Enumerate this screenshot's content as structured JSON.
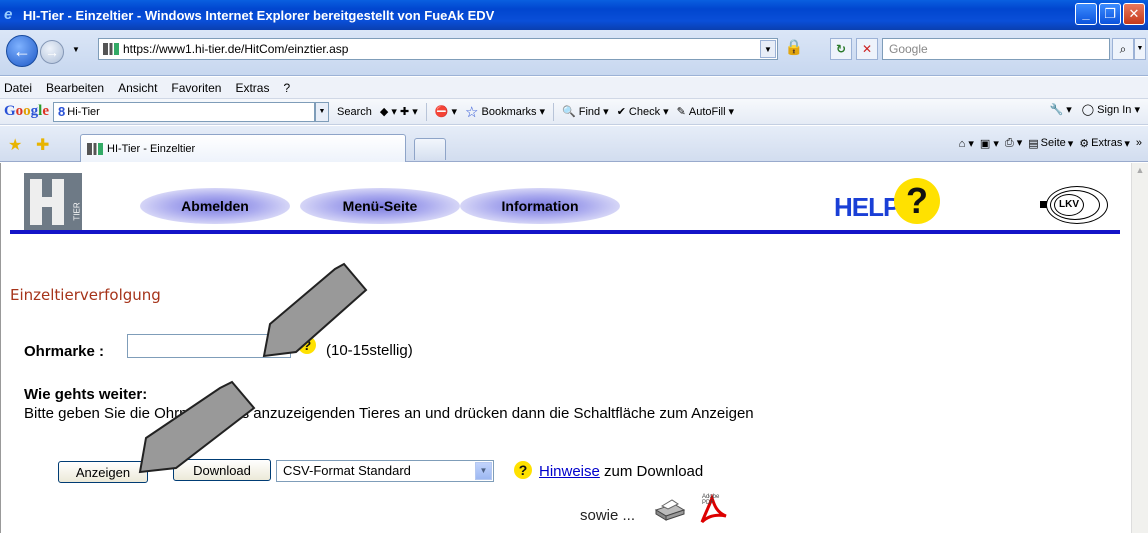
{
  "window": {
    "title": "HI-Tier - Einzeltier - Windows Internet Explorer bereitgestellt von FueAk EDV"
  },
  "addressbar": {
    "url": "https://www1.hi-tier.de/HitCom/einztier.asp",
    "search_placeholder": "Google"
  },
  "menubar": {
    "items": [
      "Datei",
      "Bearbeiten",
      "Ansicht",
      "Favoriten",
      "Extras",
      "?"
    ]
  },
  "google_toolbar": {
    "search_value": "Hi-Tier",
    "search_label": "Search",
    "bookmarks_label": "Bookmarks",
    "find_label": "Find",
    "check_label": "Check",
    "autofill_label": "AutoFill",
    "signin_label": "Sign In"
  },
  "tabs": {
    "active_label": "HI-Tier - Einzeltier",
    "seite_label": "Seite",
    "extras_label": "Extras"
  },
  "page": {
    "nav": {
      "abmelden": "Abmelden",
      "menu": "Menü-Seite",
      "information": "Information"
    },
    "help_text": "HELP",
    "help_q": "?",
    "lkv_text": "LKV",
    "logo_tier": "TIER",
    "heading": "Einzeltierverfolgung",
    "ohrmarke_label": "Ohrmarke :",
    "ohrmarke_value": "",
    "ohrmarke_hint": "(10-15stellig)",
    "howto_title": "Wie gehts weiter:",
    "howto_text": "Bitte geben Sie die Ohrmarke des anzuzeigenden Tieres an und drücken dann die Schaltfläche zum Anzeigen",
    "anzeigen_button": "Anzeigen",
    "download_button": "Download",
    "format_selected": "CSV-Format Standard",
    "hinweise_link": "Hinweise",
    "hinweise_suffix": " zum Download",
    "sowie_text": "sowie ...",
    "pdf_label": "Adobe PDF"
  }
}
